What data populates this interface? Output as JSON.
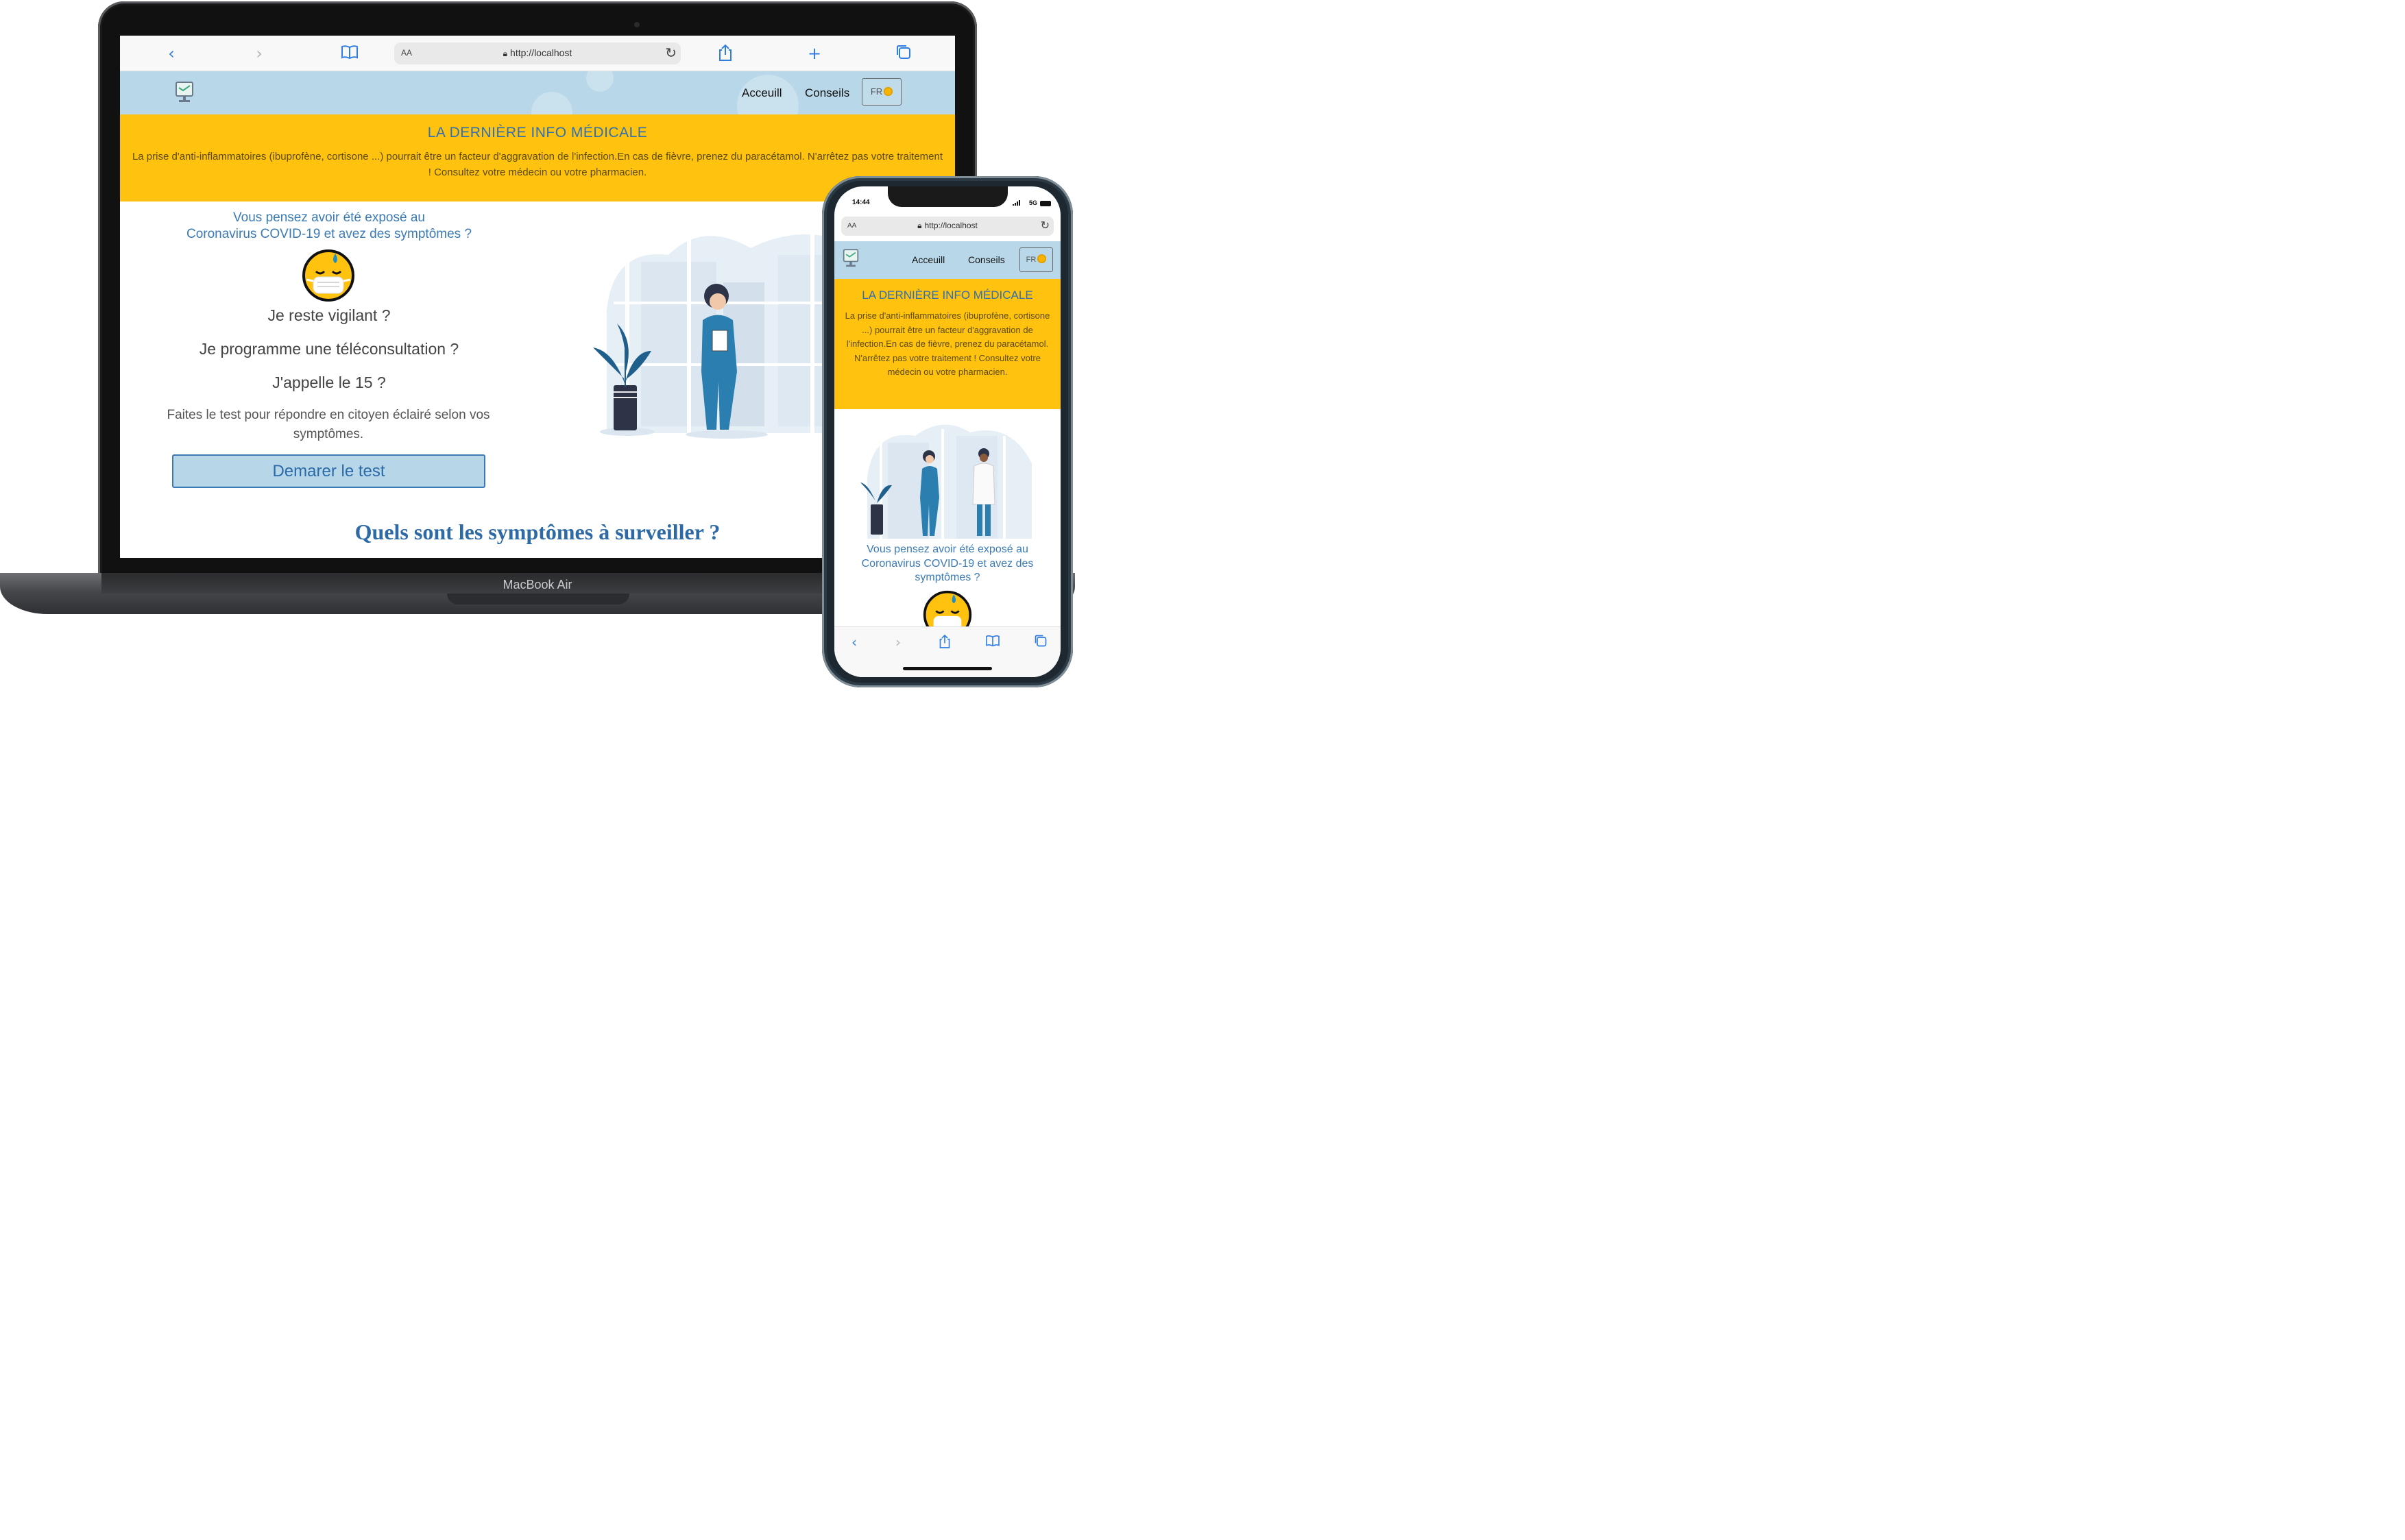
{
  "device_labels": {
    "laptop_brand": "MacBook Air"
  },
  "browser": {
    "url": "http://localhost",
    "text_size_label": "AA",
    "icons": {
      "back": "chevron-left-icon",
      "forward": "chevron-right-icon",
      "bookmarks": "book-icon",
      "share": "share-icon",
      "new_tab": "plus-icon",
      "tabs": "tabs-icon",
      "reload": "reload-icon",
      "lock": "lock-icon"
    }
  },
  "nav": {
    "links": [
      "Acceuill",
      "Conseils"
    ],
    "lang_label": "FR"
  },
  "banner": {
    "title": "LA DERNIÈRE INFO MÉDICALE",
    "text": "La prise d'anti-inflammatoires (ibuprofène, cortisone ...) pourrait être un facteur d'aggravation de l'infection.En cas de fièvre, prenez du paracétamol. N'arrêtez pas votre traitement ! Consultez votre médecin ou votre pharmacien."
  },
  "hero": {
    "question_line1": "Vous pensez avoir été exposé au",
    "question_line2": "Coronavirus COVID-19 et avez des symptômes ?",
    "question_full": "Vous pensez avoir été exposé au Coronavirus COVID-19 et avez des symptômes ?",
    "line_vigilant": "Je reste vigilant ?",
    "line_teleconsult": "Je programme une téléconsultation ?",
    "line_call": "J'appelle le 15 ?",
    "subtitle": "Faites le test pour répondre en citoyen éclairé selon vos symptômes.",
    "start_button": "Demarer le test"
  },
  "section_heading": "Quels sont les symptômes à surveiller ?",
  "phone": {
    "status_time": "14:44",
    "network": "5G"
  },
  "colors": {
    "nav_bg": "#b8d7e8",
    "banner_bg": "#ffc20e",
    "accent_blue": "#2e6fb5",
    "ios_blue": "#2f7de1"
  }
}
